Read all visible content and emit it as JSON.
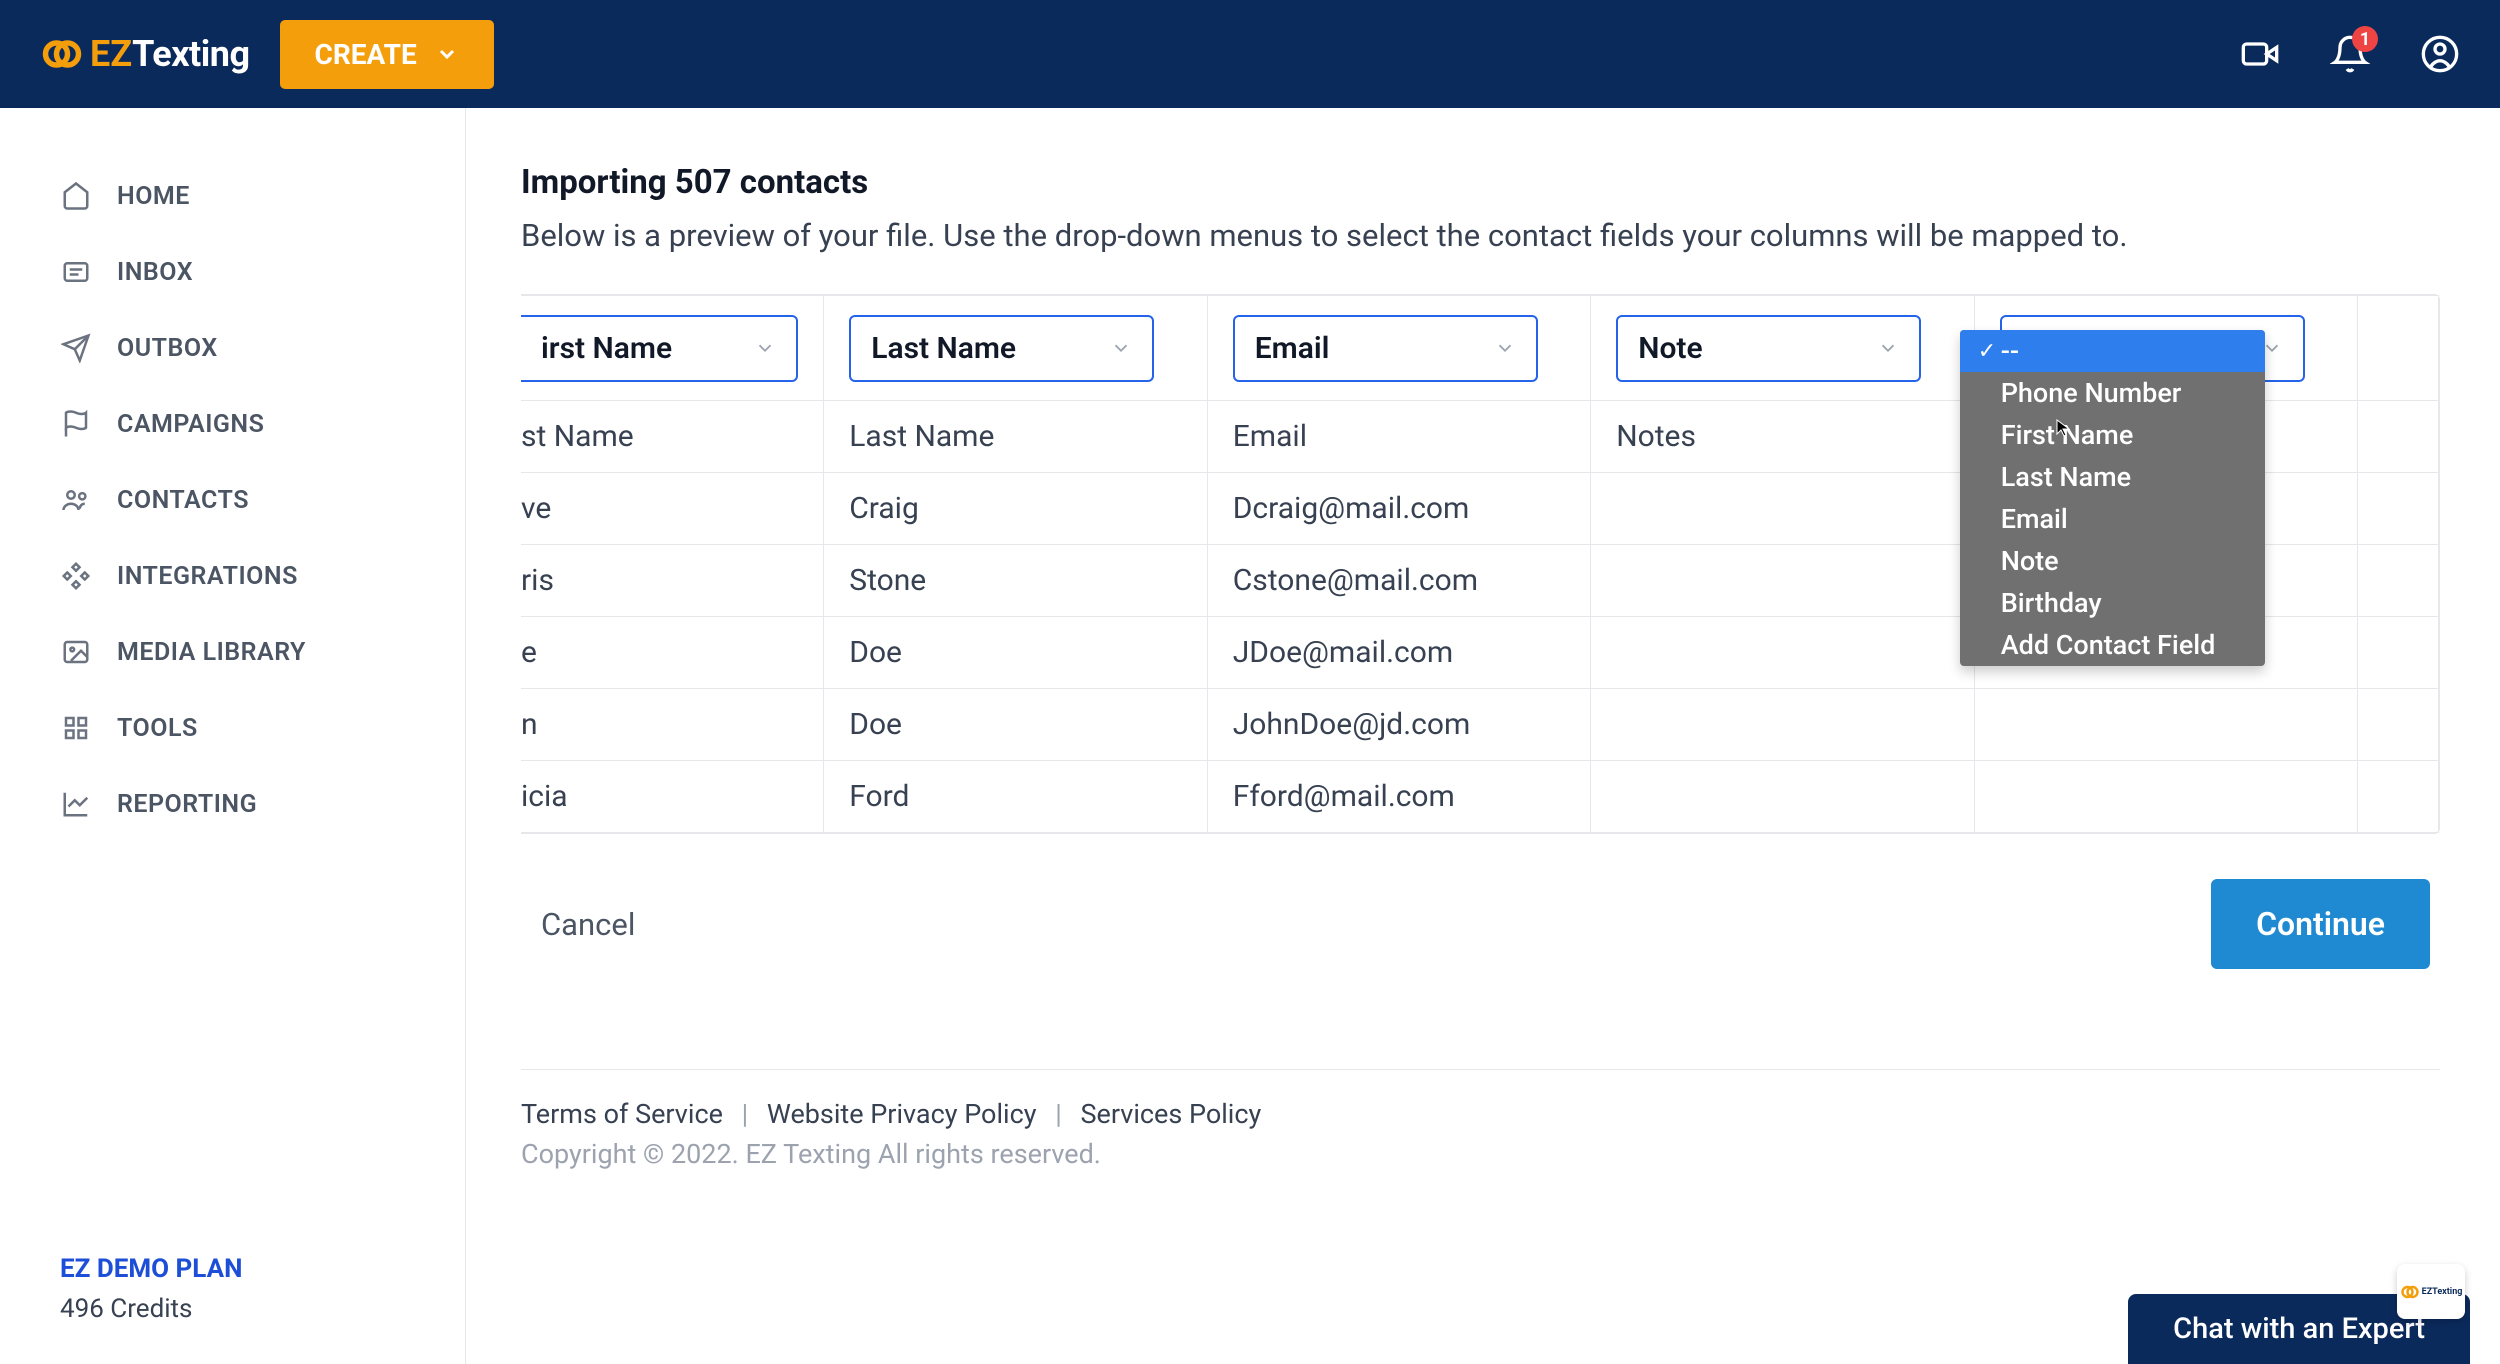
{
  "brand": {
    "ez": "EZ",
    "texting": "Texting"
  },
  "header": {
    "create": "CREATE",
    "notif_count": "1"
  },
  "sidebar": {
    "items": [
      {
        "label": "HOME"
      },
      {
        "label": "INBOX"
      },
      {
        "label": "OUTBOX"
      },
      {
        "label": "CAMPAIGNS"
      },
      {
        "label": "CONTACTS"
      },
      {
        "label": "INTEGRATIONS"
      },
      {
        "label": "MEDIA LIBRARY"
      },
      {
        "label": "TOOLS"
      },
      {
        "label": "REPORTING"
      }
    ],
    "plan": "EZ DEMO PLAN",
    "credits": "496 Credits"
  },
  "main": {
    "title": "Importing 507 contacts",
    "subtitle": "Below is a preview of your file. Use the drop-down menus to select the contact fields your columns will be mapped to."
  },
  "columns": {
    "c1": "irst Name",
    "c2": "Last Name",
    "c3": "Email",
    "c4": "Note"
  },
  "rows": [
    {
      "c1": "st Name",
      "c2": "Last Name",
      "c3": "Email",
      "c4": "Notes"
    },
    {
      "c1": "ve",
      "c2": "Craig",
      "c3": "Dcraig@mail.com",
      "c4": ""
    },
    {
      "c1": "ris",
      "c2": "Stone",
      "c3": "Cstone@mail.com",
      "c4": ""
    },
    {
      "c1": "e",
      "c2": "Doe",
      "c3": "JDoe@mail.com",
      "c4": ""
    },
    {
      "c1": "n",
      "c2": "Doe",
      "c3": "JohnDoe@jd.com",
      "c4": ""
    },
    {
      "c1": "icia",
      "c2": "Ford",
      "c3": "Fford@mail.com",
      "c4": ""
    }
  ],
  "dropdown": {
    "selected": "--",
    "options": [
      "Phone Number",
      "First Name",
      "Last Name",
      "Email",
      "Note",
      "Birthday",
      "Add Contact Field"
    ]
  },
  "actions": {
    "cancel": "Cancel",
    "continue": "Continue"
  },
  "footer": {
    "terms": "Terms of Service",
    "privacy": "Website Privacy Policy",
    "services": "Services Policy",
    "copyright": "Copyright © 2022. EZ Texting All rights reserved."
  },
  "chat": "Chat with an Expert",
  "chat_logo": "EZTexting"
}
